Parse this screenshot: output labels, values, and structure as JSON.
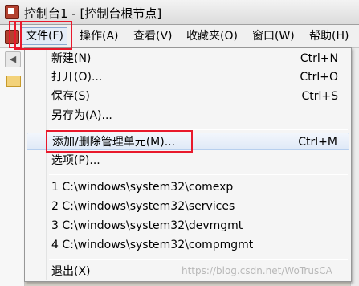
{
  "window": {
    "title": "控制台1 - [控制台根节点]"
  },
  "menubar": {
    "items": [
      {
        "label": "文件(F)"
      },
      {
        "label": "操作(A)"
      },
      {
        "label": "查看(V)"
      },
      {
        "label": "收藏夹(O)"
      },
      {
        "label": "窗口(W)"
      },
      {
        "label": "帮助(H)"
      }
    ],
    "active_item": "文件(F)"
  },
  "file_menu": {
    "new": {
      "label": "新建(N)",
      "shortcut": "Ctrl+N"
    },
    "open": {
      "label": "打开(O)...",
      "shortcut": "Ctrl+O"
    },
    "save": {
      "label": "保存(S)",
      "shortcut": "Ctrl+S"
    },
    "save_as": {
      "label": "另存为(A)..."
    },
    "add_remove_snapin": {
      "label": "添加/删除管理单元(M)...",
      "shortcut": "Ctrl+M"
    },
    "options": {
      "label": "选项(P)..."
    },
    "recent": [
      {
        "label": "1 C:\\windows\\system32\\comexp"
      },
      {
        "label": "2 C:\\windows\\system32\\services"
      },
      {
        "label": "3 C:\\windows\\system32\\devmgmt"
      },
      {
        "label": "4 C:\\windows\\system32\\compmgmt"
      }
    ],
    "exit": {
      "label": "退出(X)"
    }
  },
  "watermark": "https://blog.csdn.net/WoTrusCA",
  "colors": {
    "annotation_red": "#e8192c",
    "menu_background": "#f5f5f5",
    "hover_border": "#b7cfee"
  },
  "icons": {
    "app": "mmc-console-icon",
    "back": "back-arrow-icon",
    "folder": "folder-icon"
  }
}
